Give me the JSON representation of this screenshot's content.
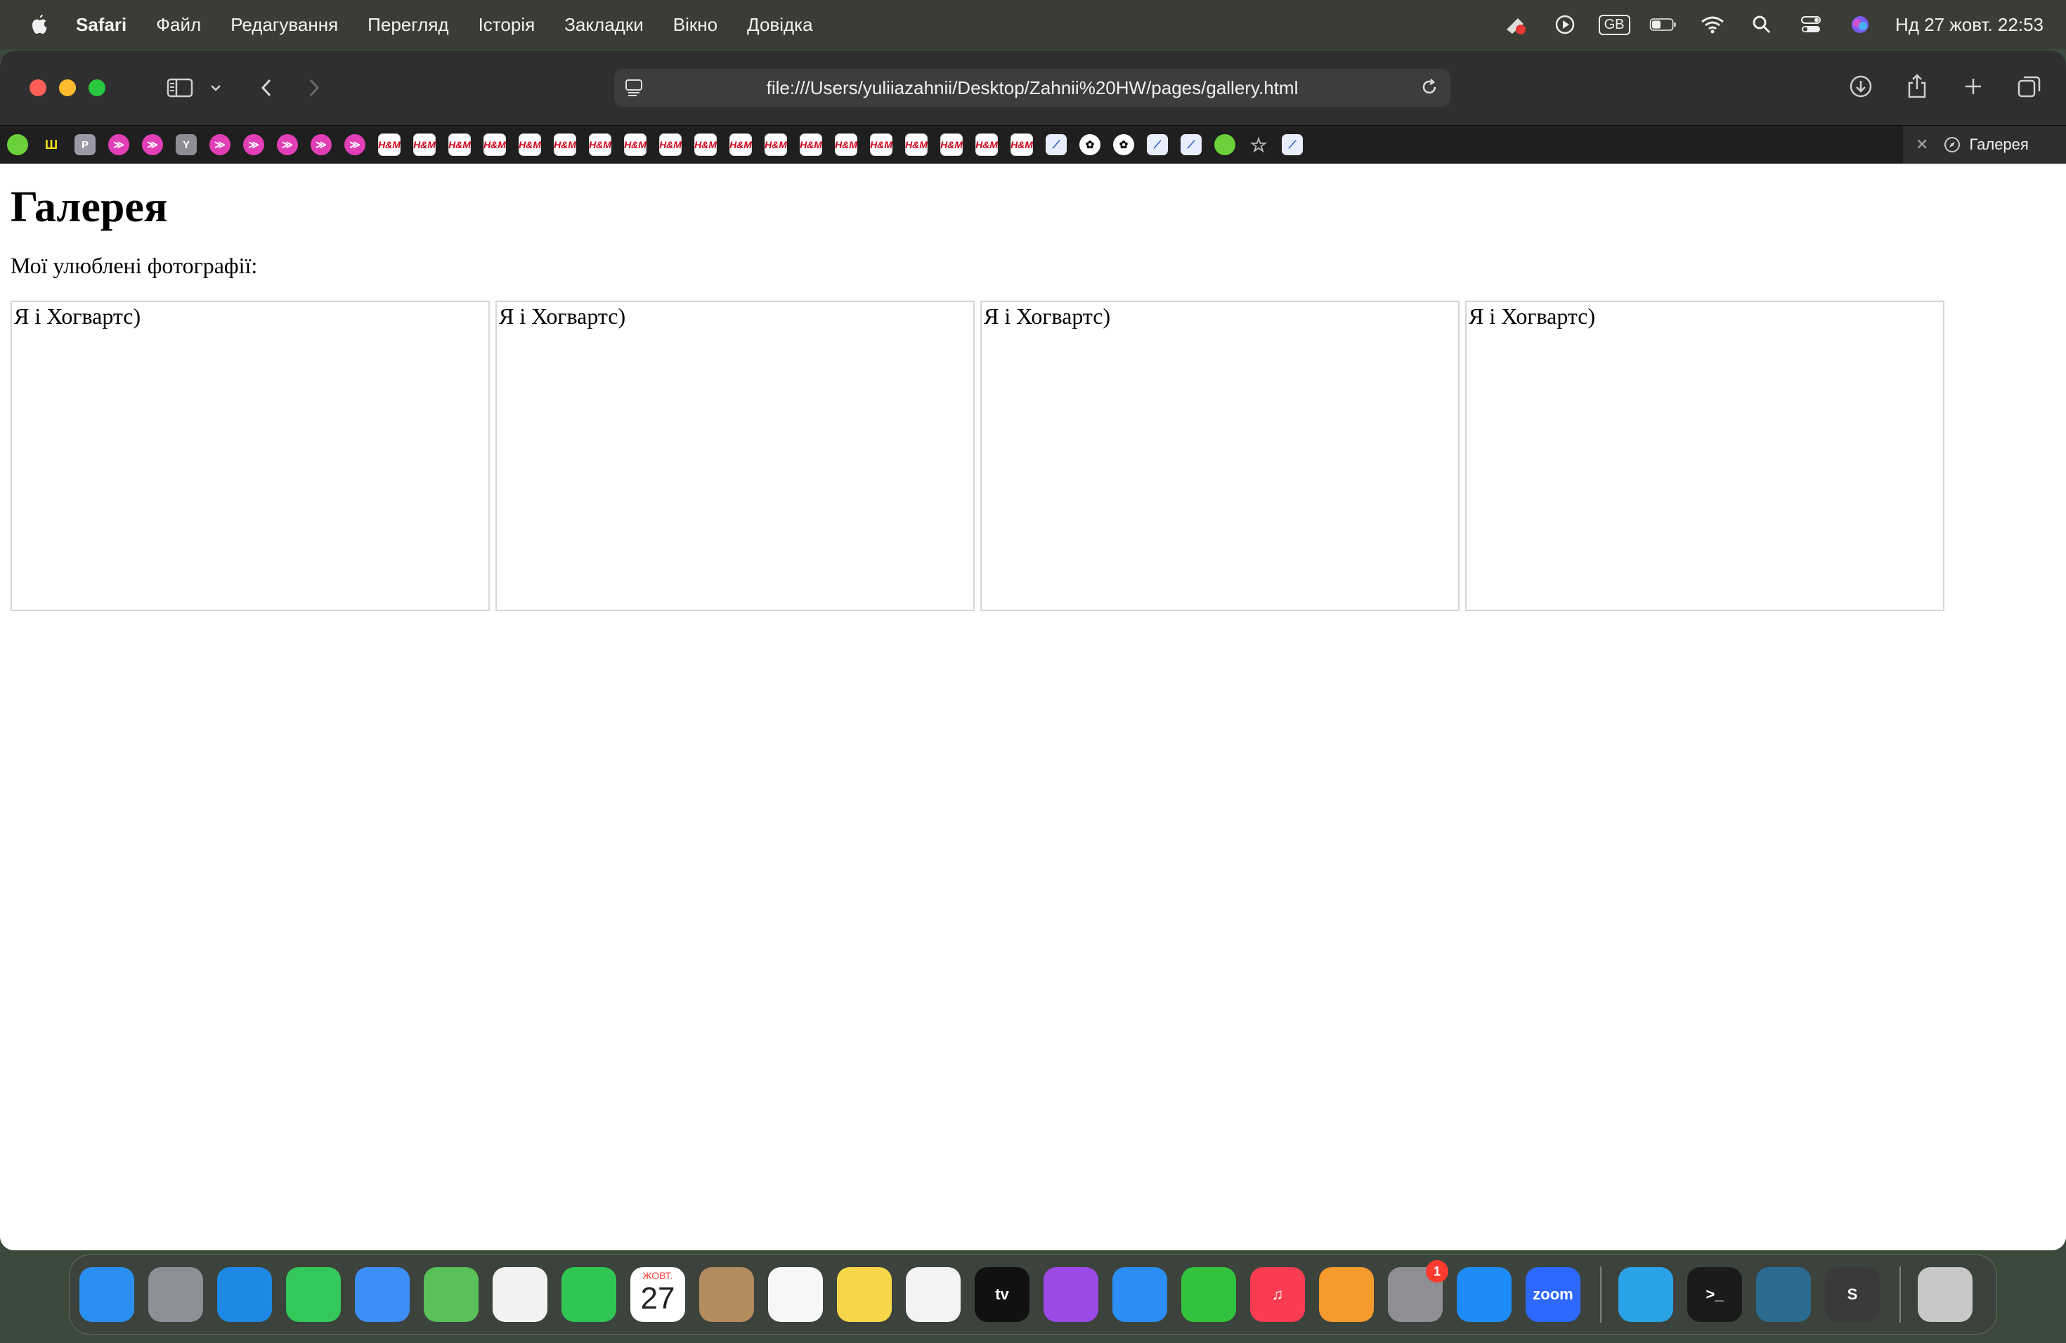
{
  "menubar": {
    "app": "Safari",
    "items": [
      "Файл",
      "Редагування",
      "Перегляд",
      "Історія",
      "Закладки",
      "Вікно",
      "Довідка"
    ],
    "keyboard_layout": "GB",
    "clock": "Нд 27 жовт.  22:53"
  },
  "browser": {
    "url": "file:///Users/yuliiazahnii/Desktop/Zahnii%20HW/pages/gallery.html",
    "active_tab_title": "Галерея",
    "favicons": [
      {
        "icon": "green-circle-favicon",
        "style": "green",
        "text": ""
      },
      {
        "icon": "yellow-logo-favicon",
        "style": "yel",
        "text": "Ш"
      },
      {
        "icon": "p-favicon",
        "style": "p",
        "text": "P"
      },
      {
        "icon": "pink-favicon",
        "style": "pink",
        "text": "≫"
      },
      {
        "icon": "pink-favicon",
        "style": "pink",
        "text": "≫"
      },
      {
        "icon": "y-favicon",
        "style": "y",
        "text": "Y"
      },
      {
        "icon": "pink-favicon",
        "style": "pink",
        "text": "≫"
      },
      {
        "icon": "pink-favicon",
        "style": "pink",
        "text": "≫"
      },
      {
        "icon": "pink-favicon",
        "style": "pink",
        "text": "≫"
      },
      {
        "icon": "pink-favicon",
        "style": "pink",
        "text": "≫"
      },
      {
        "icon": "pink-favicon",
        "style": "pink",
        "text": "≫"
      },
      {
        "icon": "hm-favicon",
        "style": "hm",
        "text": "H&M"
      },
      {
        "icon": "hm-favicon",
        "style": "hm",
        "text": "H&M"
      },
      {
        "icon": "hm-favicon",
        "style": "hm",
        "text": "H&M"
      },
      {
        "icon": "hm-favicon",
        "style": "hm",
        "text": "H&M"
      },
      {
        "icon": "hm-favicon",
        "style": "hm",
        "text": "H&M"
      },
      {
        "icon": "hm-favicon",
        "style": "hm",
        "text": "H&M"
      },
      {
        "icon": "hm-favicon",
        "style": "hm",
        "text": "H&M"
      },
      {
        "icon": "hm-favicon",
        "style": "hm",
        "text": "H&M"
      },
      {
        "icon": "hm-favicon",
        "style": "hm",
        "text": "H&M"
      },
      {
        "icon": "hm-favicon",
        "style": "hm",
        "text": "H&M"
      },
      {
        "icon": "hm-favicon",
        "style": "hm",
        "text": "H&M"
      },
      {
        "icon": "hm-favicon",
        "style": "hm",
        "text": "H&M"
      },
      {
        "icon": "hm-favicon",
        "style": "hm",
        "text": "H&M"
      },
      {
        "icon": "hm-favicon",
        "style": "hm",
        "text": "H&M"
      },
      {
        "icon": "hm-favicon",
        "style": "hm",
        "text": "H&M"
      },
      {
        "icon": "hm-favicon",
        "style": "hm",
        "text": "H&M"
      },
      {
        "icon": "hm-favicon",
        "style": "hm",
        "text": "H&M"
      },
      {
        "icon": "hm-favicon",
        "style": "hm",
        "text": "H&M"
      },
      {
        "icon": "hm-favicon",
        "style": "hm",
        "text": "H&M"
      },
      {
        "icon": "slash-favicon",
        "style": "blue",
        "text": "⟋"
      },
      {
        "icon": "chatgpt-favicon",
        "style": "gpt",
        "text": "✿"
      },
      {
        "icon": "chatgpt-favicon",
        "style": "gpt",
        "text": "✿"
      },
      {
        "icon": "slash-favicon",
        "style": "blue",
        "text": "⟋"
      },
      {
        "icon": "slash-favicon",
        "style": "blue",
        "text": "⟋"
      },
      {
        "icon": "green-circle-favicon",
        "style": "green",
        "text": ""
      },
      {
        "icon": "star-favicon",
        "style": "star",
        "text": "☆"
      },
      {
        "icon": "slash-favicon",
        "style": "blue",
        "text": "⟋"
      }
    ]
  },
  "page": {
    "title": "Галерея",
    "subtitle": "Мої улюблені фотографії:",
    "gallery": [
      {
        "caption": "Я і Хогвартс)"
      },
      {
        "caption": "Я і Хогвартс)"
      },
      {
        "caption": "Я і Хогвартс)"
      },
      {
        "caption": "Я і Хогвартс)"
      }
    ]
  },
  "dock": {
    "apps": [
      {
        "name": "finder-icon",
        "color": "#2b8ff0",
        "label": ""
      },
      {
        "name": "launchpad-icon",
        "color": "#8a8f98",
        "label": ""
      },
      {
        "name": "safari-icon",
        "color": "#1e88e5",
        "label": ""
      },
      {
        "name": "messages-icon",
        "color": "#34c759",
        "label": ""
      },
      {
        "name": "mail-icon",
        "color": "#3d8ef6",
        "label": ""
      },
      {
        "name": "maps-icon",
        "color": "#5ac05a",
        "label": ""
      },
      {
        "name": "photos-icon",
        "color": "#f2f2f2",
        "label": ""
      },
      {
        "name": "facetime-icon",
        "color": "#31c554",
        "label": ""
      },
      {
        "name": "calendar-icon",
        "color": "#ffffff",
        "label": "",
        "calendar": {
          "month": "ЖОВТ.",
          "day": "27"
        }
      },
      {
        "name": "contacts-icon",
        "color": "#b38b5d",
        "label": ""
      },
      {
        "name": "reminders-icon",
        "color": "#f7f7f7",
        "label": ""
      },
      {
        "name": "notes-icon",
        "color": "#f7d64a",
        "label": ""
      },
      {
        "name": "freeform-icon",
        "color": "#f3f3f3",
        "label": ""
      },
      {
        "name": "appletv-icon",
        "color": "#111111",
        "label": "tv"
      },
      {
        "name": "podcasts-icon",
        "color": "#9b4ae6",
        "label": ""
      },
      {
        "name": "keynote-icon",
        "color": "#2a8ef5",
        "label": ""
      },
      {
        "name": "numbers-icon",
        "color": "#33c23d",
        "label": ""
      },
      {
        "name": "music-icon",
        "color": "#fa3c52",
        "label": "♫"
      },
      {
        "name": "pages-icon",
        "color": "#f59a2c",
        "label": ""
      },
      {
        "name": "system-settings-icon",
        "color": "#8e8e93",
        "label": "",
        "badge": "1"
      },
      {
        "name": "app-store-icon",
        "color": "#1d8cf8",
        "label": ""
      },
      {
        "name": "zoom-icon",
        "color": "#2d68ff",
        "label": "zoom"
      },
      {
        "name": "telegram-icon",
        "color": "#2aa3e6",
        "label": ""
      },
      {
        "name": "terminal-icon",
        "color": "#1b1b1b",
        "label": ">_"
      },
      {
        "name": "mysql-workbench-icon",
        "color": "#2a6b8f",
        "label": ""
      },
      {
        "name": "sublime-text-icon",
        "color": "#3a3a3a",
        "label": "S"
      },
      {
        "name": "trash-icon",
        "color": "#c8c8c8",
        "label": ""
      }
    ]
  }
}
